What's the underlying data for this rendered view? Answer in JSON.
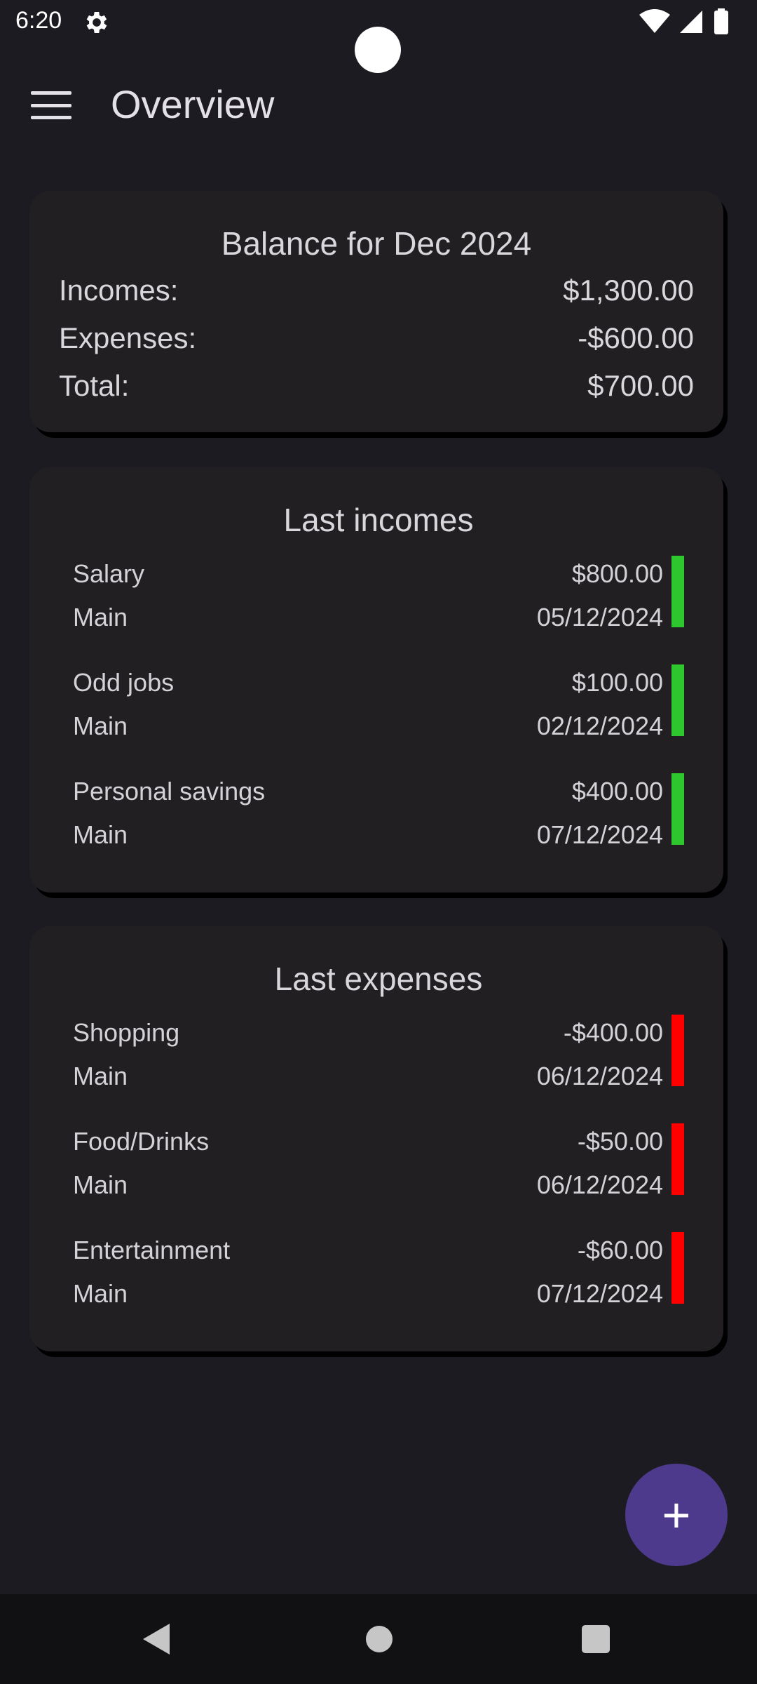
{
  "status_bar": {
    "time": "6:20"
  },
  "app_bar": {
    "title": "Overview"
  },
  "balance": {
    "title": "Balance for Dec 2024",
    "rows": [
      {
        "label": "Incomes:",
        "value": "$1,300.00"
      },
      {
        "label": "Expenses:",
        "value": "-$600.00"
      },
      {
        "label": "Total:",
        "value": "$700.00"
      }
    ]
  },
  "incomes": {
    "title": "Last incomes",
    "accent": "#2ec82e",
    "items": [
      {
        "category": "Salary",
        "amount": "$800.00",
        "account": "Main",
        "date": "05/12/2024"
      },
      {
        "category": "Odd jobs",
        "amount": "$100.00",
        "account": "Main",
        "date": "02/12/2024"
      },
      {
        "category": "Personal savings",
        "amount": "$400.00",
        "account": "Main",
        "date": "07/12/2024"
      }
    ]
  },
  "expenses": {
    "title": "Last expenses",
    "accent": "#ff0000",
    "items": [
      {
        "category": "Shopping",
        "amount": "-$400.00",
        "account": "Main",
        "date": "06/12/2024"
      },
      {
        "category": "Food/Drinks",
        "amount": "-$50.00",
        "account": "Main",
        "date": "06/12/2024"
      },
      {
        "category": "Entertainment",
        "amount": "-$60.00",
        "account": "Main",
        "date": "07/12/2024"
      }
    ]
  },
  "fab": {
    "icon": "plus-icon",
    "color": "#4d3a8c"
  }
}
